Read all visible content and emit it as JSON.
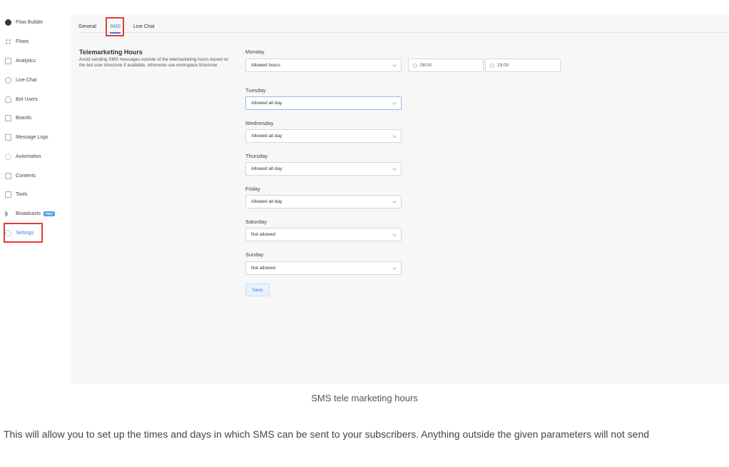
{
  "sidebar": {
    "items": [
      {
        "label": "Flow Builder",
        "icon": "chat-bubble-icon"
      },
      {
        "label": "Flows",
        "icon": "grid-icon"
      },
      {
        "label": "Analytics",
        "icon": "chart-icon"
      },
      {
        "label": "Live Chat",
        "icon": "headset-icon"
      },
      {
        "label": "Bot Users",
        "icon": "user-icon"
      },
      {
        "label": "Boards",
        "icon": "board-icon"
      },
      {
        "label": "Message Logs",
        "icon": "message-icon"
      },
      {
        "label": "Automation",
        "icon": "automation-icon"
      },
      {
        "label": "Contents",
        "icon": "contents-icon"
      },
      {
        "label": "Tools",
        "icon": "tools-icon"
      },
      {
        "label": "Broadcasts",
        "icon": "megaphone-icon",
        "badge": "PRO"
      },
      {
        "label": "Settings",
        "icon": "settings-icon",
        "active": true
      }
    ]
  },
  "tabs": [
    {
      "label": "General"
    },
    {
      "label": "SMS",
      "active": true
    },
    {
      "label": "Live Chat"
    }
  ],
  "section": {
    "title": "Telemarketing Hours",
    "description": "Avoid sending SMS messages outside of the telemarketing hours based on the bot user timezone if available, otherwise use workspace timezone"
  },
  "days": [
    {
      "label": "Monday",
      "value": "Allowed hours",
      "start": "08:00",
      "end": "19:00"
    },
    {
      "label": "Tuesday",
      "value": "Allowed all day"
    },
    {
      "label": "Wednesday",
      "value": "Allowed all day"
    },
    {
      "label": "Thursday",
      "value": "Allowed all day"
    },
    {
      "label": "Friday",
      "value": "Allowed all day"
    },
    {
      "label": "Saturday",
      "value": "Not allowed"
    },
    {
      "label": "Sunday",
      "value": "Not allowed"
    }
  ],
  "save_label": "Save",
  "caption": "SMS tele marketing hours",
  "paragraph": "This will allow you to set up the times and days in which SMS can be sent to your subscribers. Anything outside the given parameters will not send",
  "colors": {
    "accent": "#3b7fd4",
    "highlight": "#e23b3b"
  }
}
